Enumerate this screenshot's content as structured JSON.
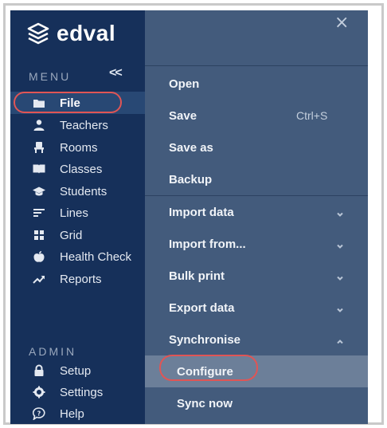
{
  "brand": {
    "name": "edval",
    "logo_icon": "layers-logo-icon"
  },
  "sidebar": {
    "menu_title": "MENU",
    "collapse_glyph": "<<",
    "admin_title": "ADMIN",
    "items": [
      {
        "label": "File",
        "icon": "folder-icon",
        "active": true
      },
      {
        "label": "Teachers",
        "icon": "person-icon"
      },
      {
        "label": "Rooms",
        "icon": "chair-icon"
      },
      {
        "label": "Classes",
        "icon": "book-icon"
      },
      {
        "label": "Students",
        "icon": "graduation-cap-icon"
      },
      {
        "label": "Lines",
        "icon": "lines-icon"
      },
      {
        "label": "Grid",
        "icon": "grid-icon"
      },
      {
        "label": "Health Check",
        "icon": "apple-icon"
      },
      {
        "label": "Reports",
        "icon": "trending-up-icon"
      }
    ],
    "admin_items": [
      {
        "label": "Setup",
        "icon": "lock-icon"
      },
      {
        "label": "Settings",
        "icon": "gear-icon"
      },
      {
        "label": "Help",
        "icon": "help-bubble-icon"
      }
    ]
  },
  "file_menu": {
    "close_glyph": "×",
    "items": [
      {
        "label": "Open"
      },
      {
        "label": "Save",
        "shortcut": "Ctrl+S"
      },
      {
        "label": "Save as"
      },
      {
        "label": "Backup"
      },
      {
        "label": "Import data",
        "expand": "down"
      },
      {
        "label": "Import from...",
        "expand": "down"
      },
      {
        "label": "Bulk print",
        "expand": "down"
      },
      {
        "label": "Export data",
        "expand": "down"
      },
      {
        "label": "Synchronise",
        "expand": "up"
      }
    ],
    "sub_items": [
      {
        "label": "Configure",
        "selected": true
      },
      {
        "label": "Sync now"
      }
    ]
  },
  "colors": {
    "sidebar_bg": "#16305a",
    "panel_bg": "#435b7c",
    "highlight": "#e05555"
  }
}
